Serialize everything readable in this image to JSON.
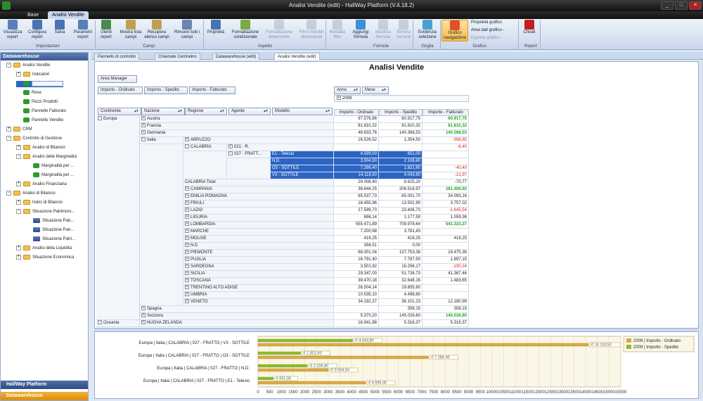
{
  "window": {
    "title": "Analisi Vendite (edit) - HallWay Platform (V.4.18.2)",
    "min": "_",
    "max": "□",
    "close": "✕"
  },
  "ribbon_tabs": [
    "Base",
    "Analisi Vendite"
  ],
  "ribbon": {
    "buttons": [
      {
        "label": "Visualizza report"
      },
      {
        "label": "Configura report"
      },
      {
        "label": "Salva"
      },
      {
        "label": "Parametri report"
      },
      {
        "label": "Utenti report"
      },
      {
        "label": "Mostra lista campi"
      },
      {
        "label": "Recupera elenco campi"
      },
      {
        "label": "Rimuovi tutti i campi"
      },
      {
        "label": "Proprietà"
      },
      {
        "label": "Formattazione condizionale"
      },
      {
        "label": "Formattazione dimensione"
      },
      {
        "label": "Filtro membri dimensione"
      },
      {
        "label": "Modalità filtro"
      },
      {
        "label": "Aggiungi formula"
      },
      {
        "label": "Modifica formula"
      },
      {
        "label": "Elimina formula"
      },
      {
        "label": "Evidenzia selezione"
      },
      {
        "label": "Grafico navigazione"
      },
      {
        "label": "Chiudi"
      }
    ],
    "groups": [
      "Impostazioni",
      "Campi",
      "Aspetto",
      "Formule",
      "Griglia",
      "Grafico",
      "Report"
    ],
    "grafico_items": [
      "Proprietà grafico",
      "Area dati grafico -",
      "Esporta grafico -"
    ]
  },
  "left_panel": {
    "header": "Datawarehouse",
    "tree": [
      {
        "label": "Analisi Vendite",
        "icon": "folder-icon",
        "exp": "−"
      },
      {
        "label": "Indicatori",
        "icon": "folder-icon",
        "exp": "+"
      },
      {
        "label": "Analisi Vendite",
        "icon": "cube-icon",
        "exp": ""
      },
      {
        "label": "Rese",
        "icon": "cube-icon",
        "exp": ""
      },
      {
        "label": "Pezzi Prodotti",
        "icon": "cube-icon",
        "exp": ""
      },
      {
        "label": "Pannello Fatturato",
        "icon": "cube-icon",
        "exp": ""
      },
      {
        "label": "Pannello Vendite",
        "icon": "cube-icon",
        "exp": ""
      },
      {
        "label": "CRM",
        "icon": "folder-icon",
        "exp": "+"
      },
      {
        "label": "Controllo di Gestione",
        "icon": "folder-icon",
        "exp": "−"
      },
      {
        "label": "Analisi di Bilancio",
        "icon": "folder-icon",
        "exp": "+"
      },
      {
        "label": "Analisi delle Marginalità",
        "icon": "folder-icon",
        "exp": "−"
      },
      {
        "label": "Marginalità per ...",
        "icon": "cube-icon",
        "exp": ""
      },
      {
        "label": "Marginalità per ...",
        "icon": "cube-icon",
        "exp": ""
      },
      {
        "label": "Analisi Finanziaria",
        "icon": "folder-icon",
        "exp": "+"
      },
      {
        "label": "Analisi di Bilancio",
        "icon": "folder-icon",
        "exp": "−"
      },
      {
        "label": "Indici di Bilancio",
        "icon": "folder-icon",
        "exp": "+"
      },
      {
        "label": "Situazione Patrimoni...",
        "icon": "folder-icon",
        "exp": "−"
      },
      {
        "label": "Situazione Patr...",
        "icon": "chip-icon",
        "exp": ""
      },
      {
        "label": "Situazione Patr...",
        "icon": "chip-icon",
        "exp": ""
      },
      {
        "label": "Situazione Patri...",
        "icon": "chip-icon",
        "exp": ""
      },
      {
        "label": "Analisi della Liquidità",
        "icon": "folder-icon",
        "exp": "+"
      },
      {
        "label": "Situazione Economica",
        "icon": "folder-icon",
        "exp": "+"
      }
    ],
    "footers": [
      "HallWay Platform",
      "Datawarehouse"
    ]
  },
  "doc_tabs": [
    "Pannello di controllo",
    "Chiamate Centralino",
    "Datawarehouse (edit)",
    "Analisi Vendite (edit)"
  ],
  "pivot": {
    "title": "Analisi Vendite",
    "filter_fields": [
      "Area Manager"
    ],
    "data_fields": [
      "Importo - Ordinato",
      "Importo - Spedito",
      "Importo - Fatturato"
    ],
    "column_fields": [
      "Anno",
      "Mese"
    ],
    "row_fields": [
      "Continente",
      "Nazione",
      "Regione",
      "Agente",
      "Modello"
    ],
    "year": "2009",
    "measure_headers": [
      "Importo - Ordinato",
      "Importo - Spedito",
      "Importo - Fatturato"
    ],
    "continents": [
      {
        "label": "Europa",
        "exp": "−"
      },
      {
        "label": "Oceania",
        "exp": "−"
      }
    ],
    "rows": [
      {
        "c2": "Austria",
        "e2": "+",
        "v": [
          "97.576,86",
          "60.917,75",
          "60.917,75"
        ],
        "f": "pos"
      },
      {
        "c2": "Francia",
        "e2": "+",
        "v": [
          "81.810,32",
          "81.810,32",
          "81.810,32"
        ],
        "f": "pos"
      },
      {
        "c2": "Germania",
        "e2": "+",
        "v": [
          "48.633,76",
          "140.368,53",
          "140.368,53"
        ],
        "f": "pos"
      },
      {
        "c2": "Italia",
        "e2": "−",
        "c3": "ABRUZZO",
        "e3": "+",
        "v": [
          "16.526,52",
          "1.354,50",
          "-398,85"
        ],
        "f": "neg"
      },
      {
        "c3": "CALABRIA",
        "e3": "−",
        "c4": "021 - R.",
        "e4": "+",
        "v": [
          "",
          "",
          "-8,40"
        ],
        "f": "neg"
      },
      {
        "c4": "027 - FRATT...",
        "e4": "−",
        "c5": "E1 - Telesio",
        "v": [
          "4.599,00",
          "651,00",
          ""
        ],
        "s": true
      },
      {
        "c5": "N.D.",
        "v": [
          "3.004,50",
          "2.108,80",
          ""
        ],
        "s": true
      },
      {
        "c5": "O3 - SOTTILE",
        "v": [
          "7.286,40",
          "1.821,60",
          "-40,40"
        ],
        "s": true,
        "f": "neg"
      },
      {
        "c5": "V3 - SOTTILE",
        "v": [
          "14.118,50",
          "4.043,80",
          "-21,97"
        ],
        "s": true,
        "f": "neg"
      },
      {
        "c3t": "CALABRIA Total",
        "v": [
          "29.008,40",
          "8.625,20",
          "-70,77"
        ]
      },
      {
        "c3": "CAMPANIA",
        "e3": "+",
        "v": [
          "38.644,25",
          "206.516,97",
          "181.406,92"
        ],
        "f": "pos"
      },
      {
        "c3": "EMILIA ROMAGNA",
        "e3": "+",
        "v": [
          "65.537,73",
          "65.001,70",
          "34.093,16"
        ]
      },
      {
        "c3": "FRIULI",
        "e3": "+",
        "v": [
          "18.455,96",
          "13.502,90",
          "3.757,02"
        ]
      },
      {
        "c3": "LAZIO",
        "e3": "+",
        "v": [
          "27.599,70",
          "23.406,73",
          "-1.645,54"
        ],
        "f": "neg"
      },
      {
        "c3": "LIGURIA",
        "e3": "+",
        "v": [
          "696,14",
          "1.177,59",
          "1.059,36"
        ]
      },
      {
        "c3": "LOMBARDIA",
        "e3": "+",
        "v": [
          "555.471,89",
          "709.978,64",
          "541.323,37"
        ],
        "f": "pos"
      },
      {
        "c3": "MARCHE",
        "e3": "+",
        "v": [
          "7.200,98",
          "3.781,43",
          ""
        ]
      },
      {
        "c3": "MOLISE",
        "e3": "+",
        "v": [
          "416,25",
          "416,25",
          "416,25"
        ]
      },
      {
        "c3": "N.D",
        "e3": "+",
        "v": [
          "356,51",
          "0,00",
          ""
        ]
      },
      {
        "c3": "PIEMONTE",
        "e3": "+",
        "v": [
          "68.301,04",
          "137.753,38",
          "19.475,36"
        ]
      },
      {
        "c3": "PUGLIA",
        "e3": "+",
        "v": [
          "16.791,40",
          "7.787,50",
          "1.897,15"
        ]
      },
      {
        "c3": "SARDEGNA",
        "e3": "+",
        "v": [
          "3.501,92",
          "16.256,17",
          "-190,34"
        ],
        "f": "neg"
      },
      {
        "c3": "SICILIA",
        "e3": "+",
        "v": [
          "29.347,00",
          "51.726,73",
          "41.367,46"
        ]
      },
      {
        "c3": "TOSCANA",
        "e3": "+",
        "v": [
          "39.470,18",
          "32.648,16",
          "1.483,65"
        ]
      },
      {
        "c3": "TRENTINO ALTO ADIGE",
        "e3": "+",
        "v": [
          "26.504,14",
          "19.655,60",
          ""
        ]
      },
      {
        "c3": "UMBRIA",
        "e3": "+",
        "v": [
          "10.535,10",
          "4.498,80",
          ""
        ]
      },
      {
        "c3": "VENETO",
        "e3": "+",
        "v": [
          "34.192,37",
          "36.101,23",
          "12.180,99"
        ]
      },
      {
        "c2": "Spagna",
        "e2": "+",
        "v": [
          "",
          "358,15",
          "358,15"
        ]
      },
      {
        "c2": "Svizzera",
        "e2": "+",
        "v": [
          "5.370,20",
          "145.026,60",
          "145.026,60"
        ],
        "f": "pos"
      },
      {
        "c2": "NUOVA ZELANDA",
        "e2": "+",
        "v": [
          "16.941,88",
          "5.316,37",
          "5.316,37"
        ]
      }
    ]
  },
  "chart_data": {
    "type": "bar",
    "orientation": "horizontal",
    "categories": [
      "Europa | Italia | CALABRIA | 027 - FRATTO | V3 - SOTTILE",
      "Europa | Italia | CALABRIA | 027 - FRATTO | O3 - SOTTILE",
      "Europa | Italia | CALABRIA | 027 - FRATTO | N.D.",
      "Europa | Italia | CALABRIA | 027 - FRATTO | E1 - Telesio"
    ],
    "series": [
      {
        "name": "2009 | Importo - Ordinato",
        "values": [
          14118.5,
          7286.4,
          3004.5,
          4599.0
        ],
        "labels": [
          "€ 14.118,50",
          "€ 7.286,40",
          "€ 3.004,50",
          "€ 4.599,00"
        ],
        "color": "#e0a845"
      },
      {
        "name": "2009 | Importo - Spedito",
        "values": [
          4043.8,
          1821.6,
          2108.8,
          651.0
        ],
        "labels": [
          "€ 4.043,80",
          "€ 1.821,60",
          "€ 2.108,80",
          "€ 651,00"
        ],
        "color": "#8bbf2a"
      }
    ],
    "xticks": [
      0,
      500,
      1000,
      1500,
      2000,
      2500,
      3000,
      3500,
      4000,
      4500,
      5000,
      5500,
      6000,
      6500,
      7000,
      7500,
      8000,
      8500,
      9000,
      9500,
      10000,
      10500,
      11000,
      11500,
      12000,
      12500,
      13000,
      13500,
      14000,
      14500,
      15000,
      15500
    ],
    "xlim": [
      0,
      15500
    ],
    "legend": "right",
    "grid": true
  }
}
